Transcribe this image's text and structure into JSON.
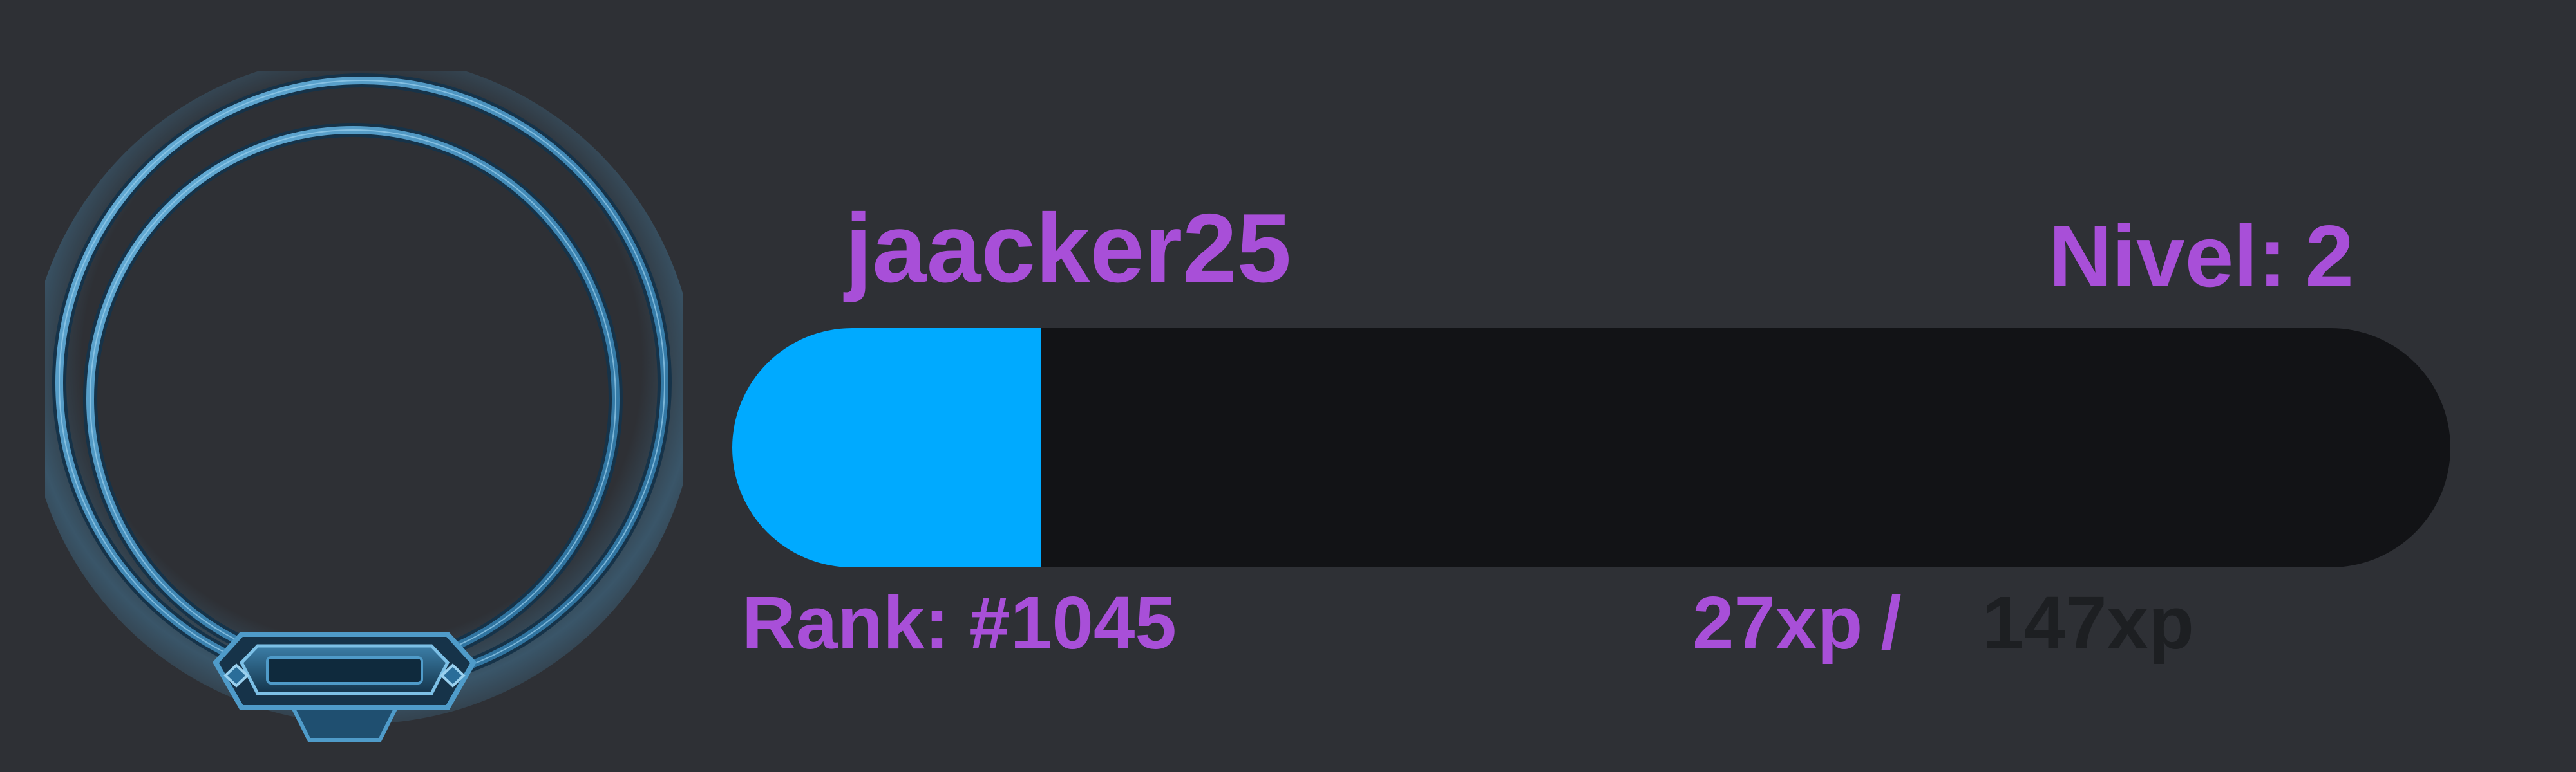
{
  "colors": {
    "background": "#2e3035",
    "accent_text": "#a84fd8",
    "muted_text": "#1d1f22",
    "bar_track": "#121316",
    "bar_fill": "#00aaff",
    "frame_ring": "#4f9bc9",
    "frame_ring_dark": "#163349"
  },
  "avatar": {
    "frame_icon": "avatar-ring-frame-icon"
  },
  "profile": {
    "username": "jaacker25",
    "level_label": "Nivel:",
    "level_value": "2",
    "rank_label": "Rank:",
    "rank_value": "#1045"
  },
  "xp": {
    "current": "27xp",
    "separator": "/",
    "total": "147xp",
    "progress_fraction": 0.18
  }
}
